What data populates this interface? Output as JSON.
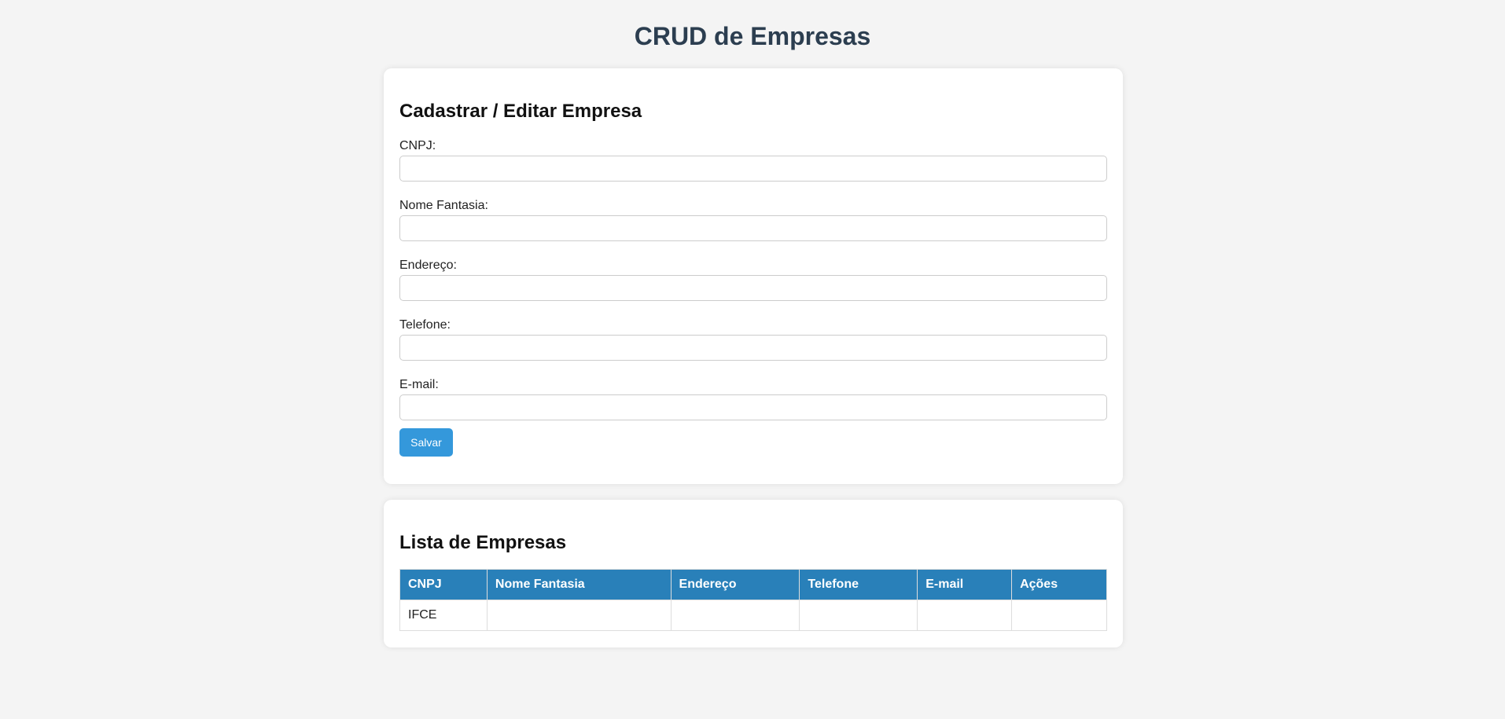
{
  "page": {
    "title": "CRUD de Empresas"
  },
  "form": {
    "title": "Cadastrar / Editar Empresa",
    "fields": [
      {
        "label": "CNPJ:",
        "value": ""
      },
      {
        "label": "Nome Fantasia:",
        "value": ""
      },
      {
        "label": "Endereço:",
        "value": ""
      },
      {
        "label": "Telefone:",
        "value": ""
      },
      {
        "label": "E-mail:",
        "value": ""
      }
    ],
    "save_label": "Salvar"
  },
  "list": {
    "title": "Lista de Empresas",
    "columns": [
      "CNPJ",
      "Nome Fantasia",
      "Endereço",
      "Telefone",
      "E-mail",
      "Ações"
    ],
    "rows": [
      [
        "IFCE",
        "",
        "",
        "",
        "",
        ""
      ]
    ]
  },
  "colors": {
    "page_background": "#f4f4f4",
    "title_color": "#2c3e50",
    "button_color": "#3498db",
    "table_header_color": "#2980b9"
  }
}
